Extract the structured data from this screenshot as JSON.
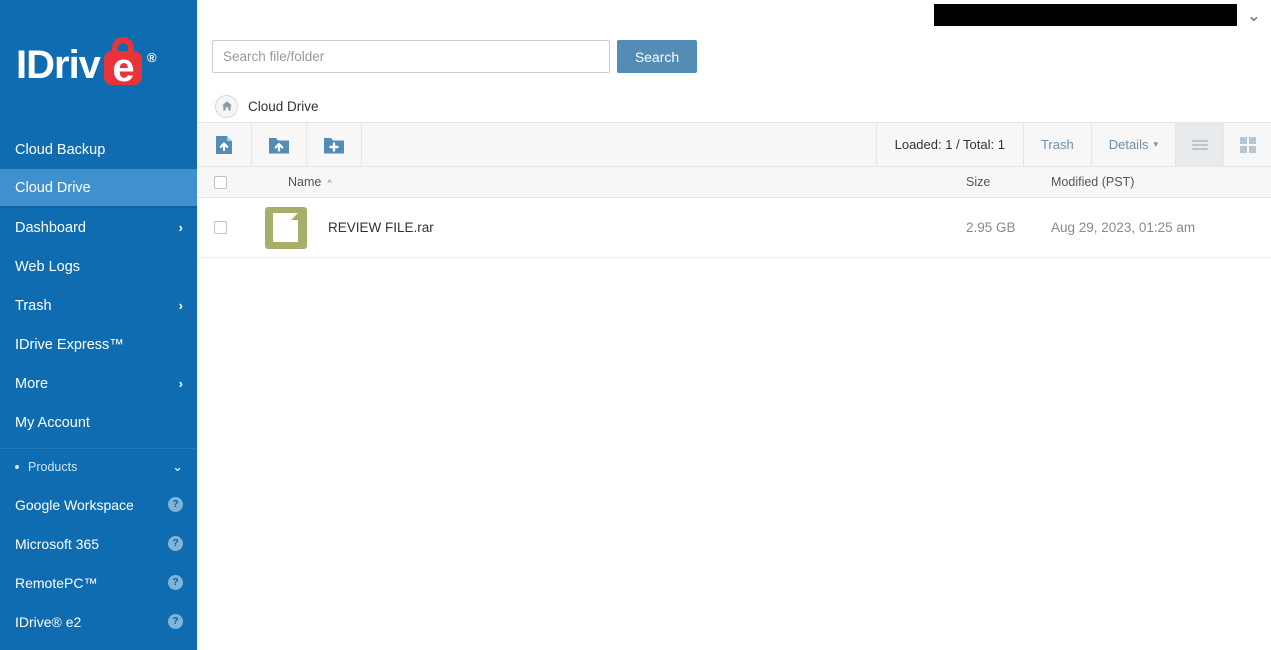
{
  "brand": {
    "logo_text_1": "IDriv",
    "logo_letter_e": "e",
    "logo_registered": "®",
    "sidebar_bg": "#0f6cb0",
    "active_bg": "#3e90cf",
    "accent_red": "#e8333a",
    "button_blue": "#538cb4"
  },
  "sidebar": {
    "items": [
      {
        "label": "Cloud Backup",
        "chevron": "",
        "active": false
      },
      {
        "label": "Cloud Drive",
        "chevron": "",
        "active": true
      },
      {
        "label": "Dashboard",
        "chevron": "›",
        "active": false
      },
      {
        "label": "Web Logs",
        "chevron": "",
        "active": false
      },
      {
        "label": "Trash",
        "chevron": "›",
        "active": false
      },
      {
        "label": "IDrive Express™",
        "chevron": "",
        "active": false
      },
      {
        "label": "More",
        "chevron": "›",
        "active": false
      },
      {
        "label": "My Account",
        "chevron": "",
        "active": false
      }
    ],
    "products_header": {
      "label": "Products",
      "caret": "⌄"
    },
    "products": [
      {
        "label": "Google Workspace",
        "help": "?"
      },
      {
        "label": "Microsoft 365",
        "help": "?"
      },
      {
        "label": "RemotePC™",
        "help": "?"
      },
      {
        "label": "IDrive® e2",
        "help": "?"
      }
    ]
  },
  "account": {
    "name_redacted": "",
    "caret": "⌄"
  },
  "search": {
    "placeholder": "Search file/folder",
    "value": "",
    "button_label": "Search"
  },
  "breadcrumb": {
    "home_icon": "home-icon",
    "label": "Cloud Drive"
  },
  "toolbar": {
    "upload_file_icon": "upload-file-icon",
    "upload_folder_icon": "upload-folder-icon",
    "new_folder_icon": "new-folder-icon",
    "loaded_text": "Loaded: 1 / Total: 1",
    "trash_label": "Trash",
    "details_label": "Details",
    "details_caret": "▾",
    "list_view_icon": "list-view-icon",
    "grid_view_icon": "grid-view-icon",
    "active_view": "list"
  },
  "table": {
    "columns": {
      "name": "Name",
      "sort_caret": "^",
      "size": "Size",
      "modified": "Modified (PST)"
    },
    "rows": [
      {
        "name": "REVIEW FILE.rar",
        "size": "2.95 GB",
        "modified": "Aug 29, 2023, 01:25 am",
        "icon": "archive-file-icon",
        "selected": false
      }
    ]
  }
}
